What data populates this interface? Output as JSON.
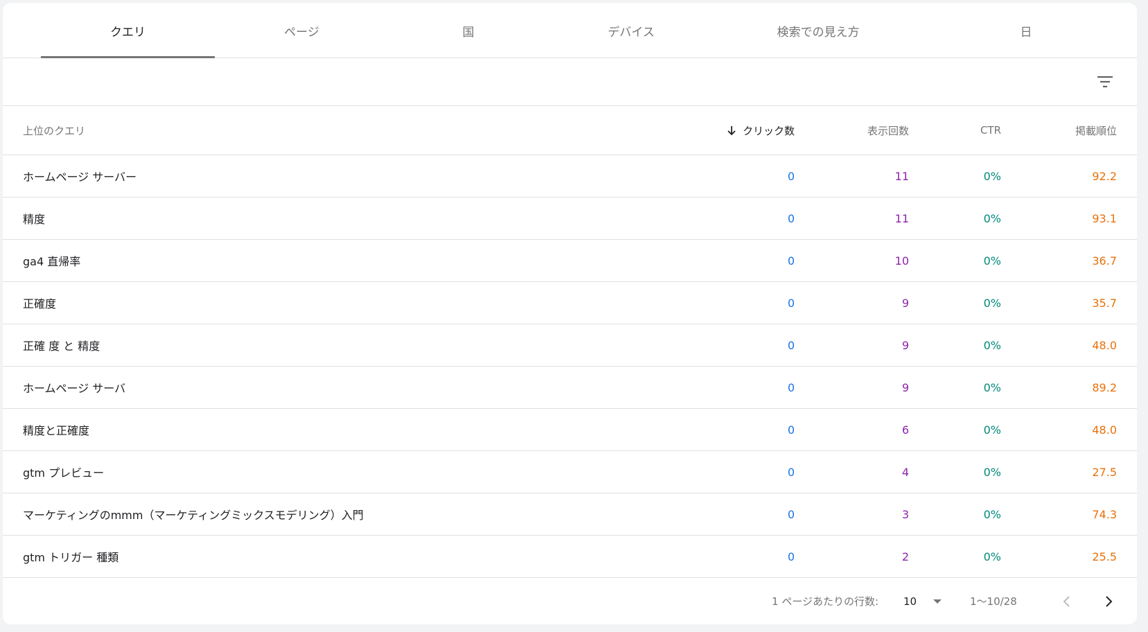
{
  "tabs": [
    {
      "label": "クエリ",
      "active": true
    },
    {
      "label": "ページ",
      "active": false
    },
    {
      "label": "国",
      "active": false
    },
    {
      "label": "デバイス",
      "active": false
    },
    {
      "label": "検索での見え方",
      "active": false
    },
    {
      "label": "日",
      "active": false
    }
  ],
  "toolbar": {
    "filter_icon": "filter-list-icon"
  },
  "table": {
    "headers": {
      "query": "上位のクエリ",
      "clicks": "クリック数",
      "impressions": "表示回数",
      "ctr": "CTR",
      "position": "掲載順位"
    },
    "sort_icon": "arrow-down-icon",
    "rows": [
      {
        "query": "ホームページ サーバー",
        "clicks": "0",
        "impressions": "11",
        "ctr": "0%",
        "position": "92.2"
      },
      {
        "query": "精度",
        "clicks": "0",
        "impressions": "11",
        "ctr": "0%",
        "position": "93.1"
      },
      {
        "query": "ga4 直帰率",
        "clicks": "0",
        "impressions": "10",
        "ctr": "0%",
        "position": "36.7"
      },
      {
        "query": "正確度",
        "clicks": "0",
        "impressions": "9",
        "ctr": "0%",
        "position": "35.7"
      },
      {
        "query": "正確 度 と 精度",
        "clicks": "0",
        "impressions": "9",
        "ctr": "0%",
        "position": "48.0"
      },
      {
        "query": "ホームページ サーバ",
        "clicks": "0",
        "impressions": "9",
        "ctr": "0%",
        "position": "89.2"
      },
      {
        "query": "精度と正確度",
        "clicks": "0",
        "impressions": "6",
        "ctr": "0%",
        "position": "48.0"
      },
      {
        "query": "gtm プレビュー",
        "clicks": "0",
        "impressions": "4",
        "ctr": "0%",
        "position": "27.5"
      },
      {
        "query": "マーケティングのmmm（マーケティングミックスモデリング）入門",
        "clicks": "0",
        "impressions": "3",
        "ctr": "0%",
        "position": "74.3"
      },
      {
        "query": "gtm トリガー 種類",
        "clicks": "0",
        "impressions": "2",
        "ctr": "0%",
        "position": "25.5"
      }
    ]
  },
  "pagination": {
    "rows_per_page_label": "1 ページあたりの行数:",
    "rows_per_page_value": "10",
    "range": "1〜10/28",
    "prev_icon": "chevron-left-icon",
    "next_icon": "chevron-right-icon"
  },
  "colors": {
    "clicks": "#1a73e8",
    "impressions": "#8e24aa",
    "ctr": "#00897b",
    "position": "#e8710a"
  }
}
